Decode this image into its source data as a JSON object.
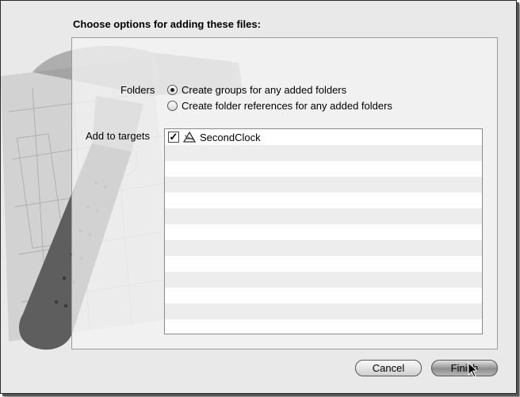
{
  "dialog": {
    "title": "Choose options for adding these files:",
    "folders_label": "Folders",
    "folder_options": [
      {
        "label": "Create groups for any added folders",
        "selected": true
      },
      {
        "label": "Create folder references for any added folders",
        "selected": false
      }
    ],
    "targets_label": "Add to targets",
    "targets": [
      {
        "name": "SecondClock",
        "checked": true,
        "icon": "application-target-icon"
      }
    ],
    "empty_rows": 12
  },
  "buttons": {
    "cancel": "Cancel",
    "finish": "Finish"
  },
  "icons": {
    "background": "xcode-hammer-blueprint-icon",
    "cursor": "mouse-pointer-icon"
  }
}
